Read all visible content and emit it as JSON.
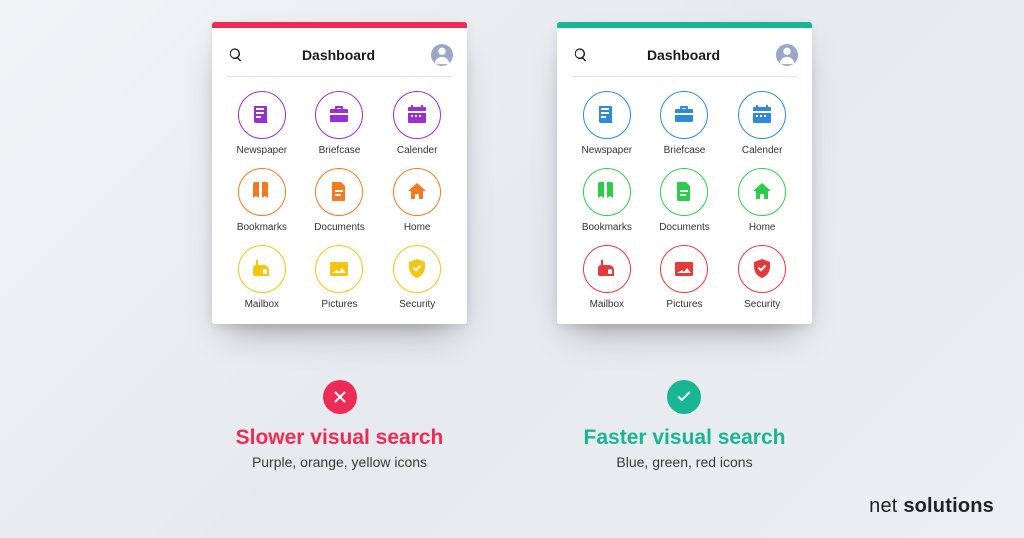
{
  "brand": {
    "word1": "net",
    "word2": "solutions"
  },
  "panels": [
    {
      "id": "bad",
      "accent": "#ed2b57",
      "header": {
        "title": "Dashboard"
      },
      "verdict": {
        "symbol": "cross",
        "headline": "Slower visual search",
        "sub": "Purple, orange, yellow icons"
      },
      "rows": [
        {
          "colorClass": "c-purple",
          "items": [
            {
              "icon": "newspaper",
              "label": "Newspaper"
            },
            {
              "icon": "briefcase",
              "label": "Briefcase"
            },
            {
              "icon": "calendar",
              "label": "Calender"
            }
          ]
        },
        {
          "colorClass": "c-orange",
          "items": [
            {
              "icon": "bookmarks",
              "label": "Bookmarks"
            },
            {
              "icon": "documents",
              "label": "Documents"
            },
            {
              "icon": "home",
              "label": "Home"
            }
          ]
        },
        {
          "colorClass": "c-yellow",
          "items": [
            {
              "icon": "mailbox",
              "label": "Mailbox"
            },
            {
              "icon": "pictures",
              "label": "Pictures"
            },
            {
              "icon": "security",
              "label": "Security"
            }
          ]
        }
      ]
    },
    {
      "id": "good",
      "accent": "#19b694",
      "header": {
        "title": "Dashboard"
      },
      "verdict": {
        "symbol": "check",
        "headline": "Faster visual search",
        "sub": "Blue, green, red icons"
      },
      "rows": [
        {
          "colorClass": "c-blue",
          "items": [
            {
              "icon": "newspaper",
              "label": "Newspaper"
            },
            {
              "icon": "briefcase",
              "label": "Briefcase"
            },
            {
              "icon": "calendar",
              "label": "Calender"
            }
          ]
        },
        {
          "colorClass": "c-green",
          "items": [
            {
              "icon": "bookmarks",
              "label": "Bookmarks"
            },
            {
              "icon": "documents",
              "label": "Documents"
            },
            {
              "icon": "home",
              "label": "Home"
            }
          ]
        },
        {
          "colorClass": "c-red",
          "items": [
            {
              "icon": "mailbox",
              "label": "Mailbox"
            },
            {
              "icon": "pictures",
              "label": "Pictures"
            },
            {
              "icon": "security",
              "label": "Security"
            }
          ]
        }
      ]
    }
  ]
}
